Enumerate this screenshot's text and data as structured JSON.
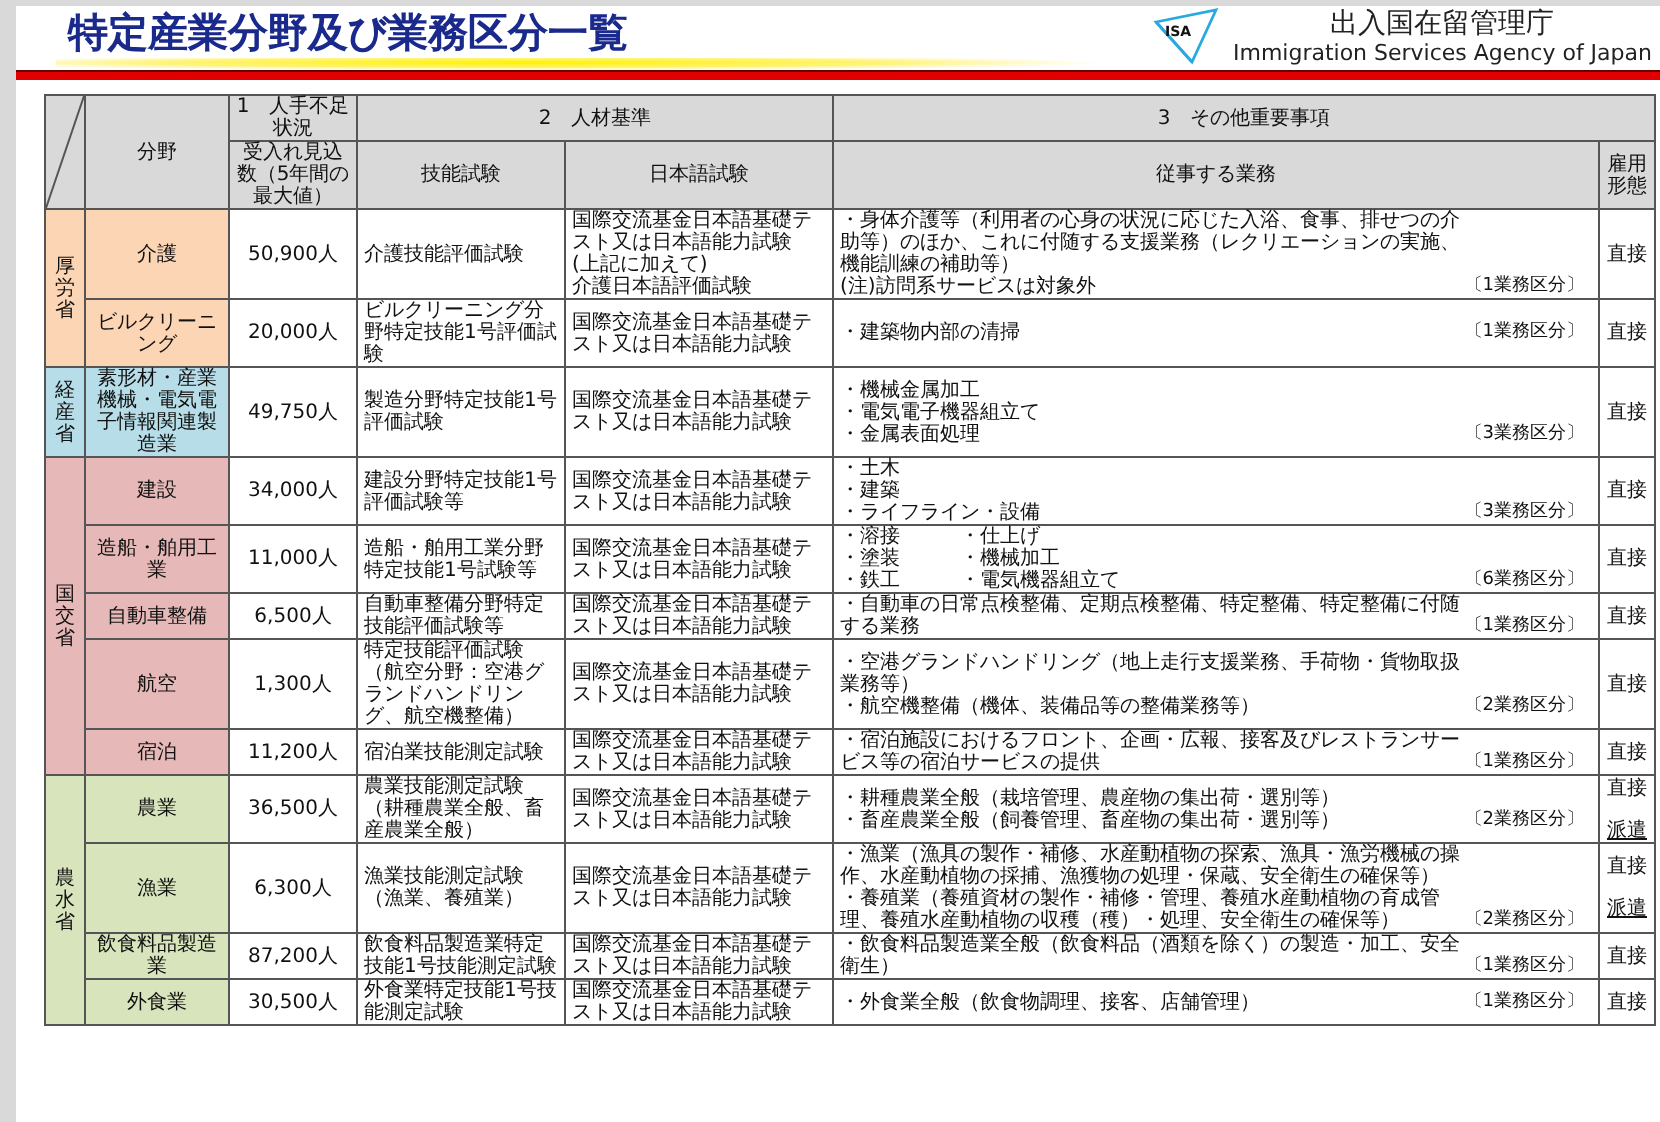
{
  "title": "特定産業分野及び業務区分一覧",
  "agency": {
    "logo_text": "ISA",
    "name": "出入国在留管理庁",
    "name_en": "Immigration Services Agency of Japan"
  },
  "table": {
    "group_headers": [
      "1　人手不足状況",
      "2　人材基準",
      "3　その他重要事項"
    ],
    "columns": [
      "分野",
      "受入れ見込数（5年間の最大値）",
      "技能試験",
      "日本語試験",
      "従事する業務",
      "雇用形態"
    ],
    "ministries": [
      {
        "name": "厚労省",
        "color": "#fcd5b4",
        "fields": [
          {
            "kind": "list",
            "name": "介護",
            "quota": "50,900人",
            "skill_test": "介護技能評価試験",
            "language_test": [
              "国際交流基金日本語基礎テスト又は日本語能力試験",
              "(上記に加えて)",
              "介護日本語評価試験"
            ],
            "tasks": [
              "・身体介護等（利用者の心身の状況に応じた入浴、食事、排せつの介助等）のほか、これに付随する支援業務（レクリエーションの実施、機能訓練の補助等）",
              "(注)訪問系サービスは対象外"
            ],
            "task_count": "〔1業務区分〕",
            "employment": [
              {
                "label": "直接",
                "underlined": false
              }
            ]
          },
          {
            "kind": "list",
            "name": "ビルクリーニング",
            "quota": "20,000人",
            "skill_test": "ビルクリーニング分野特定技能1号評価試験",
            "language_test": [
              "国際交流基金日本語基礎テスト又は日本語能力試験"
            ],
            "tasks": [
              "・建築物内部の清掃"
            ],
            "task_count": "〔1業務区分〕",
            "employment": [
              {
                "label": "直接",
                "underlined": false
              }
            ]
          }
        ]
      },
      {
        "name": "経産省",
        "color": "#b7dee8",
        "fields": [
          {
            "kind": "list",
            "name": "素形材・産業機械・電気電子情報関連製造業",
            "quota": "49,750人",
            "skill_test": "製造分野特定技能1号評価試験",
            "language_test": [
              "国際交流基金日本語基礎テスト又は日本語能力試験"
            ],
            "tasks": [
              "・機械金属加工",
              "・電気電子機器組立て",
              "・金属表面処理"
            ],
            "task_count": "〔3業務区分〕",
            "employment": [
              {
                "label": "直接",
                "underlined": false
              }
            ]
          }
        ]
      },
      {
        "name": "国交省",
        "color": "#e6b9b8",
        "fields": [
          {
            "kind": "list",
            "name": "建設",
            "quota": "34,000人",
            "skill_test": "建設分野特定技能1号評価試験等",
            "language_test": [
              "国際交流基金日本語基礎テスト又は日本語能力試験"
            ],
            "tasks": [
              "・土木",
              "・建築",
              "・ライフライン・設備"
            ],
            "task_count": "〔3業務区分〕",
            "employment": [
              {
                "label": "直接",
                "underlined": false
              }
            ]
          },
          {
            "kind": "two_column",
            "name": "造船・舶用工業",
            "quota": "11,000人",
            "skill_test": "造船・舶用工業分野特定技能1号試験等",
            "language_test": [
              "国際交流基金日本語基礎テスト又は日本語能力試験"
            ],
            "tasks": [
              "・溶接",
              "・塗装",
              "・鉄工",
              "・仕上げ",
              "・機械加工",
              "・電気機器組立て"
            ],
            "task_count": "〔6業務区分〕",
            "employment": [
              {
                "label": "直接",
                "underlined": false
              }
            ]
          },
          {
            "kind": "list",
            "name": "自動車整備",
            "quota": "6,500人",
            "skill_test": "自動車整備分野特定技能評価試験等",
            "language_test": [
              "国際交流基金日本語基礎テスト又は日本語能力試験"
            ],
            "tasks": [
              "・自動車の日常点検整備、定期点検整備、特定整備、特定整備に付随する業務"
            ],
            "task_count": "〔1業務区分〕",
            "employment": [
              {
                "label": "直接",
                "underlined": false
              }
            ]
          },
          {
            "kind": "list",
            "name": "航空",
            "quota": "1,300人",
            "skill_test": "特定技能評価試験（航空分野：空港グランドハンドリング、航空機整備）",
            "language_test": [
              "国際交流基金日本語基礎テスト又は日本語能力試験"
            ],
            "tasks": [
              "・空港グランドハンドリング（地上走行支援業務、手荷物・貨物取扱業務等）",
              "・航空機整備（機体、装備品等の整備業務等）"
            ],
            "task_count": "〔2業務区分〕",
            "employment": [
              {
                "label": "直接",
                "underlined": false
              }
            ]
          },
          {
            "kind": "list",
            "name": "宿泊",
            "quota": "11,200人",
            "skill_test": "宿泊業技能測定試験",
            "language_test": [
              "国際交流基金日本語基礎テスト又は日本語能力試験"
            ],
            "tasks": [
              "・宿泊施設におけるフロント、企画・広報、接客及びレストランサービス等の宿泊サービスの提供"
            ],
            "task_count": "〔1業務区分〕",
            "employment": [
              {
                "label": "直接",
                "underlined": false
              }
            ]
          }
        ]
      },
      {
        "name": "農水省",
        "color": "#d8e4bc",
        "fields": [
          {
            "kind": "list",
            "name": "農業",
            "quota": "36,500人",
            "skill_test": "農業技能測定試験（耕種農業全般、畜産農業全般）",
            "language_test": [
              "国際交流基金日本語基礎テスト又は日本語能力試験"
            ],
            "tasks": [
              "・耕種農業全般（栽培管理、農産物の集出荷・選別等）",
              "・畜産農業全般（飼養管理、畜産物の集出荷・選別等）"
            ],
            "task_count": "〔2業務区分〕",
            "employment": [
              {
                "label": "直接",
                "underlined": false
              },
              {
                "label": "派遣",
                "underlined": true
              }
            ]
          },
          {
            "kind": "list",
            "name": "漁業",
            "quota": "6,300人",
            "skill_test": "漁業技能測定試験（漁業、養殖業）",
            "language_test": [
              "国際交流基金日本語基礎テスト又は日本語能力試験"
            ],
            "tasks": [
              "・漁業（漁具の製作・補修、水産動植物の探索、漁具・漁労機械の操作、水産動植物の採捕、漁獲物の処理・保蔵、安全衛生の確保等）",
              "・養殖業（養殖資材の製作・補修・管理、養殖水産動植物の育成管理、養殖水産動植物の収穫（穫）・処理、安全衛生の確保等）"
            ],
            "task_count": "〔2業務区分〕",
            "employment": [
              {
                "label": "直接",
                "underlined": false
              },
              {
                "label": "派遣",
                "underlined": true
              }
            ]
          },
          {
            "kind": "list",
            "name": "飲食料品製造業",
            "quota": "87,200人",
            "skill_test": "飲食料品製造業特定技能1号技能測定試験",
            "language_test": [
              "国際交流基金日本語基礎テスト又は日本語能力試験"
            ],
            "tasks": [
              "・飲食料品製造業全般（飲食料品（酒類を除く）の製造・加工、安全衛生）"
            ],
            "task_count": "〔1業務区分〕",
            "employment": [
              {
                "label": "直接",
                "underlined": false
              }
            ]
          },
          {
            "kind": "list",
            "name": "外食業",
            "quota": "30,500人",
            "skill_test": "外食業特定技能1号技能測定試験",
            "language_test": [
              "国際交流基金日本語基礎テスト又は日本語能力試験"
            ],
            "tasks": [
              "・外食業全般（飲食物調理、接客、店舗管理）"
            ],
            "task_count": "〔1業務区分〕",
            "employment": [
              {
                "label": "直接",
                "underlined": false
              }
            ]
          }
        ]
      }
    ]
  }
}
